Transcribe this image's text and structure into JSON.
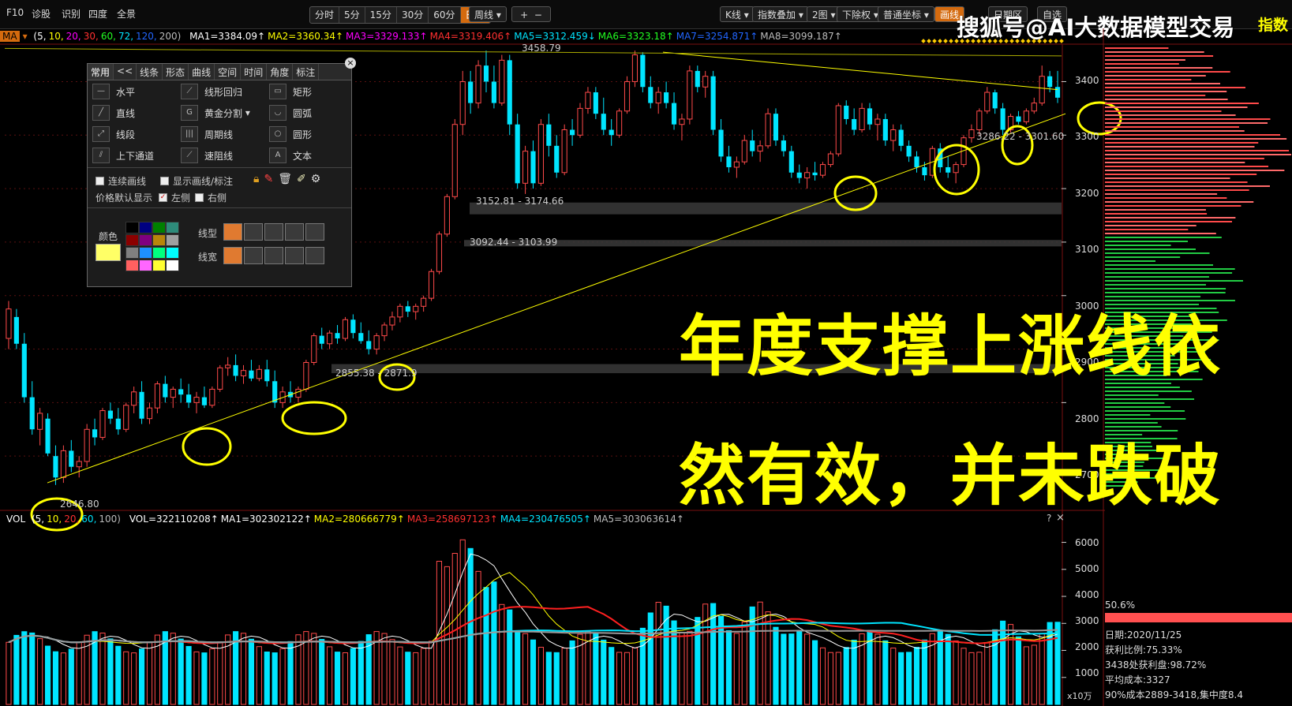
{
  "toolbar": {
    "left_items": [
      "F10",
      "诊股",
      "识别",
      "四度",
      "全景"
    ],
    "periods": [
      "分时",
      "5分",
      "15分",
      "30分",
      "60分",
      "日线"
    ],
    "active_period": "日线",
    "week_select": "周线",
    "plus": "+",
    "minus": "−",
    "kline_select": "K线",
    "index_overlay": "指数叠加",
    "two_charts": "2图",
    "exright": "下除权",
    "coord": "普通坐标",
    "draw_line": "画线",
    "right_partial": "日期区",
    "self_select": "自选"
  },
  "watermark": "搜狐号@AI大数据模型交易",
  "corner_label": "指数",
  "ma_bar": {
    "tag": "MA",
    "params": [
      {
        "text": "(5,",
        "color": "#ffffff"
      },
      {
        "text": "10,",
        "color": "#ffff00"
      },
      {
        "text": "20,",
        "color": "#ff00ff"
      },
      {
        "text": "30,",
        "color": "#ff3030"
      },
      {
        "text": "60,",
        "color": "#22ff22"
      },
      {
        "text": "72,",
        "color": "#00e5ff"
      },
      {
        "text": "120,",
        "color": "#2266ff"
      },
      {
        "text": "200)",
        "color": "#bbbbbb"
      }
    ],
    "values": [
      {
        "text": "MA1=3384.09↑",
        "color": "#ffffff"
      },
      {
        "text": "MA2=3360.34↑",
        "color": "#ffff00"
      },
      {
        "text": "MA3=3329.133↑",
        "color": "#ff00ff"
      },
      {
        "text": "MA4=3319.406↑",
        "color": "#ff3030"
      },
      {
        "text": "MA5=3312.459↓",
        "color": "#00e5ff"
      },
      {
        "text": "MA6=3323.18↑",
        "color": "#22ff22"
      },
      {
        "text": "MA7=3254.871↑",
        "color": "#2266ff"
      },
      {
        "text": "MA8=3099.187↑",
        "color": "#bbbbbb"
      }
    ]
  },
  "draw_panel": {
    "tabs": [
      "常用",
      "<<",
      "线条",
      "形态",
      "曲线",
      "空间",
      "时间",
      "角度",
      "标注"
    ],
    "tools": [
      [
        "水平",
        "线形回归",
        "矩形"
      ],
      [
        "直线",
        "黄金分割",
        "圆弧"
      ],
      [
        "线段",
        "周期线",
        "圆形"
      ],
      [
        "上下通道",
        "速阻线",
        "文本"
      ]
    ],
    "opt_continuous": "连续画线",
    "opt_show": "显示画线/标注",
    "opt_price_default": "价格默认显示",
    "opt_left": "左侧",
    "opt_right": "右侧",
    "color_label": "颜色",
    "linetype_label": "线型",
    "linewidth_label": "线宽",
    "swatch_colors": [
      "#000000",
      "#000080",
      "#008000",
      "#2e8b7a",
      "#8b0000",
      "#800080",
      "#b8860b",
      "#a0a0a0",
      "#808080",
      "#1e90ff",
      "#00ff7f",
      "#00ffff",
      "#ff6060",
      "#ff66ff",
      "#ffff33",
      "#ffffff"
    ],
    "selected_color": "#ffff66"
  },
  "price_labels": {
    "high": "3458.79",
    "low": "2646.80",
    "box1": "3152.81 - 3174.66",
    "box2": "3092.44 - 3103.99",
    "box3": "2855.38 - 2871.9",
    "box4": "3286.22 - 3301.60"
  },
  "price_axis": [
    "3400",
    "3300",
    "3200",
    "3100",
    "3000",
    "2900",
    "2800",
    "2700"
  ],
  "vol_axis": [
    "6000",
    "5000",
    "4000",
    "3000",
    "2000",
    "1000"
  ],
  "vol_unit": "x10万",
  "vol_bar": {
    "tag": "VOL",
    "params": [
      {
        "text": "(5,",
        "color": "#ffffff"
      },
      {
        "text": "10,",
        "color": "#ffff00"
      },
      {
        "text": "20,",
        "color": "#ff3030"
      },
      {
        "text": "60,",
        "color": "#00e5ff"
      },
      {
        "text": "100)",
        "color": "#bbbbbb"
      }
    ],
    "values": [
      {
        "text": "VOL=322110208↑",
        "color": "#ffffff"
      },
      {
        "text": "MA1=302302122↑",
        "color": "#ffffff"
      },
      {
        "text": "MA2=280666779↑",
        "color": "#ffff00"
      },
      {
        "text": "MA3=258697123↑",
        "color": "#ff3030"
      },
      {
        "text": "MA4=230476505↑",
        "color": "#00e5ff"
      },
      {
        "text": "MA5=303063614↑",
        "color": "#bbbbbb"
      }
    ],
    "help": "?",
    "close": "×"
  },
  "overlay_text": {
    "line1": "年度支撑上涨线依",
    "line2": "然有效，并未跌破"
  },
  "right_info": {
    "percent": "50.6%",
    "date": "日期:2020/11/25",
    "profit_ratio": "获利比例:75.33%",
    "profit_plate": "3438处获利盘:98.72%",
    "avg_cost": "平均成本:3327",
    "cost_90": "90%成本2889-3418,集中度8.4"
  },
  "colors": {
    "up": "#ff4a4a",
    "down": "#00e5ff",
    "trend": "#ffff00",
    "circle": "#ffff00",
    "active": "#d46a0e"
  },
  "chart_data": {
    "type": "candlestick",
    "series_note": "",
    "price_range": [
      2600,
      3470
    ],
    "candles": [
      {
        "o": 2920,
        "h": 2990,
        "l": 2900,
        "c": 2975
      },
      {
        "o": 2960,
        "h": 2975,
        "l": 2900,
        "c": 2910
      },
      {
        "o": 2910,
        "h": 2930,
        "l": 2800,
        "c": 2810
      },
      {
        "o": 2810,
        "h": 2840,
        "l": 2740,
        "c": 2750
      },
      {
        "o": 2750,
        "h": 2790,
        "l": 2720,
        "c": 2780
      },
      {
        "o": 2770,
        "h": 2780,
        "l": 2700,
        "c": 2705
      },
      {
        "o": 2700,
        "h": 2720,
        "l": 2646,
        "c": 2660
      },
      {
        "o": 2660,
        "h": 2720,
        "l": 2650,
        "c": 2710
      },
      {
        "o": 2710,
        "h": 2730,
        "l": 2670,
        "c": 2680
      },
      {
        "o": 2680,
        "h": 2700,
        "l": 2660,
        "c": 2690
      },
      {
        "o": 2690,
        "h": 2760,
        "l": 2680,
        "c": 2750
      },
      {
        "o": 2750,
        "h": 2770,
        "l": 2720,
        "c": 2735
      },
      {
        "o": 2735,
        "h": 2790,
        "l": 2730,
        "c": 2785
      },
      {
        "o": 2785,
        "h": 2800,
        "l": 2760,
        "c": 2770
      },
      {
        "o": 2770,
        "h": 2790,
        "l": 2740,
        "c": 2750
      },
      {
        "o": 2750,
        "h": 2800,
        "l": 2745,
        "c": 2795
      },
      {
        "o": 2795,
        "h": 2830,
        "l": 2780,
        "c": 2820
      },
      {
        "o": 2820,
        "h": 2840,
        "l": 2760,
        "c": 2770
      },
      {
        "o": 2770,
        "h": 2800,
        "l": 2760,
        "c": 2790
      },
      {
        "o": 2790,
        "h": 2840,
        "l": 2780,
        "c": 2835
      },
      {
        "o": 2835,
        "h": 2850,
        "l": 2800,
        "c": 2810
      },
      {
        "o": 2810,
        "h": 2830,
        "l": 2790,
        "c": 2825
      },
      {
        "o": 2825,
        "h": 2845,
        "l": 2800,
        "c": 2815
      },
      {
        "o": 2815,
        "h": 2835,
        "l": 2790,
        "c": 2800
      },
      {
        "o": 2800,
        "h": 2820,
        "l": 2780,
        "c": 2810
      },
      {
        "o": 2810,
        "h": 2830,
        "l": 2790,
        "c": 2795
      },
      {
        "o": 2795,
        "h": 2830,
        "l": 2790,
        "c": 2825
      },
      {
        "o": 2825,
        "h": 2870,
        "l": 2820,
        "c": 2865
      },
      {
        "o": 2865,
        "h": 2885,
        "l": 2850,
        "c": 2870
      },
      {
        "o": 2870,
        "h": 2890,
        "l": 2840,
        "c": 2850
      },
      {
        "o": 2850,
        "h": 2870,
        "l": 2835,
        "c": 2860
      },
      {
        "o": 2860,
        "h": 2880,
        "l": 2840,
        "c": 2845
      },
      {
        "o": 2845,
        "h": 2870,
        "l": 2840,
        "c": 2862
      },
      {
        "o": 2862,
        "h": 2880,
        "l": 2830,
        "c": 2840
      },
      {
        "o": 2840,
        "h": 2860,
        "l": 2790,
        "c": 2800
      },
      {
        "o": 2800,
        "h": 2830,
        "l": 2790,
        "c": 2820
      },
      {
        "o": 2820,
        "h": 2840,
        "l": 2800,
        "c": 2810
      },
      {
        "o": 2810,
        "h": 2830,
        "l": 2800,
        "c": 2825
      },
      {
        "o": 2825,
        "h": 2880,
        "l": 2820,
        "c": 2875
      },
      {
        "o": 2875,
        "h": 2930,
        "l": 2870,
        "c": 2925
      },
      {
        "o": 2925,
        "h": 2940,
        "l": 2900,
        "c": 2910
      },
      {
        "o": 2910,
        "h": 2935,
        "l": 2900,
        "c": 2930
      },
      {
        "o": 2930,
        "h": 2945,
        "l": 2910,
        "c": 2920
      },
      {
        "o": 2920,
        "h": 2960,
        "l": 2915,
        "c": 2955
      },
      {
        "o": 2955,
        "h": 2965,
        "l": 2920,
        "c": 2930
      },
      {
        "o": 2930,
        "h": 2950,
        "l": 2910,
        "c": 2915
      },
      {
        "o": 2915,
        "h": 2935,
        "l": 2890,
        "c": 2900
      },
      {
        "o": 2900,
        "h": 2930,
        "l": 2890,
        "c": 2925
      },
      {
        "o": 2925,
        "h": 2950,
        "l": 2915,
        "c": 2945
      },
      {
        "o": 2945,
        "h": 2970,
        "l": 2935,
        "c": 2960
      },
      {
        "o": 2960,
        "h": 2985,
        "l": 2950,
        "c": 2980
      },
      {
        "o": 2980,
        "h": 2990,
        "l": 2960,
        "c": 2970
      },
      {
        "o": 2970,
        "h": 2985,
        "l": 2955,
        "c": 2980
      },
      {
        "o": 2980,
        "h": 3000,
        "l": 2970,
        "c": 2995
      },
      {
        "o": 2995,
        "h": 3050,
        "l": 2990,
        "c": 3045
      },
      {
        "o": 3045,
        "h": 3120,
        "l": 3040,
        "c": 3115
      },
      {
        "o": 3115,
        "h": 3190,
        "l": 3110,
        "c": 3185
      },
      {
        "o": 3185,
        "h": 3330,
        "l": 3180,
        "c": 3320
      },
      {
        "o": 3320,
        "h": 3420,
        "l": 3300,
        "c": 3400
      },
      {
        "o": 3400,
        "h": 3420,
        "l": 3340,
        "c": 3360
      },
      {
        "o": 3360,
        "h": 3440,
        "l": 3350,
        "c": 3430
      },
      {
        "o": 3430,
        "h": 3458,
        "l": 3380,
        "c": 3400
      },
      {
        "o": 3400,
        "h": 3430,
        "l": 3350,
        "c": 3360
      },
      {
        "o": 3360,
        "h": 3450,
        "l": 3355,
        "c": 3440
      },
      {
        "o": 3440,
        "h": 3450,
        "l": 3300,
        "c": 3320
      },
      {
        "o": 3320,
        "h": 3340,
        "l": 3200,
        "c": 3210
      },
      {
        "o": 3210,
        "h": 3280,
        "l": 3190,
        "c": 3270
      },
      {
        "o": 3270,
        "h": 3290,
        "l": 3200,
        "c": 3210
      },
      {
        "o": 3210,
        "h": 3330,
        "l": 3205,
        "c": 3320
      },
      {
        "o": 3320,
        "h": 3340,
        "l": 3260,
        "c": 3280
      },
      {
        "o": 3280,
        "h": 3300,
        "l": 3220,
        "c": 3230
      },
      {
        "o": 3230,
        "h": 3320,
        "l": 3225,
        "c": 3310
      },
      {
        "o": 3310,
        "h": 3330,
        "l": 3280,
        "c": 3300
      },
      {
        "o": 3300,
        "h": 3360,
        "l": 3295,
        "c": 3350
      },
      {
        "o": 3350,
        "h": 3390,
        "l": 3340,
        "c": 3380
      },
      {
        "o": 3380,
        "h": 3390,
        "l": 3330,
        "c": 3340
      },
      {
        "o": 3340,
        "h": 3370,
        "l": 3300,
        "c": 3310
      },
      {
        "o": 3310,
        "h": 3330,
        "l": 3280,
        "c": 3300
      },
      {
        "o": 3300,
        "h": 3350,
        "l": 3295,
        "c": 3345
      },
      {
        "o": 3345,
        "h": 3410,
        "l": 3340,
        "c": 3400
      },
      {
        "o": 3400,
        "h": 3458,
        "l": 3390,
        "c": 3450
      },
      {
        "o": 3450,
        "h": 3455,
        "l": 3380,
        "c": 3390
      },
      {
        "o": 3390,
        "h": 3410,
        "l": 3350,
        "c": 3360
      },
      {
        "o": 3360,
        "h": 3390,
        "l": 3340,
        "c": 3380
      },
      {
        "o": 3380,
        "h": 3400,
        "l": 3350,
        "c": 3360
      },
      {
        "o": 3360,
        "h": 3380,
        "l": 3310,
        "c": 3320
      },
      {
        "o": 3320,
        "h": 3340,
        "l": 3290,
        "c": 3330
      },
      {
        "o": 3330,
        "h": 3430,
        "l": 3320,
        "c": 3420
      },
      {
        "o": 3420,
        "h": 3430,
        "l": 3380,
        "c": 3390
      },
      {
        "o": 3390,
        "h": 3420,
        "l": 3370,
        "c": 3410
      },
      {
        "o": 3410,
        "h": 3420,
        "l": 3300,
        "c": 3310
      },
      {
        "o": 3310,
        "h": 3330,
        "l": 3250,
        "c": 3260
      },
      {
        "o": 3260,
        "h": 3280,
        "l": 3230,
        "c": 3240
      },
      {
        "o": 3240,
        "h": 3260,
        "l": 3220,
        "c": 3250
      },
      {
        "o": 3250,
        "h": 3300,
        "l": 3245,
        "c": 3290
      },
      {
        "o": 3290,
        "h": 3310,
        "l": 3260,
        "c": 3270
      },
      {
        "o": 3270,
        "h": 3290,
        "l": 3250,
        "c": 3280
      },
      {
        "o": 3280,
        "h": 3350,
        "l": 3275,
        "c": 3340
      },
      {
        "o": 3340,
        "h": 3350,
        "l": 3280,
        "c": 3290
      },
      {
        "o": 3290,
        "h": 3300,
        "l": 3260,
        "c": 3270
      },
      {
        "o": 3270,
        "h": 3280,
        "l": 3220,
        "c": 3230
      },
      {
        "o": 3230,
        "h": 3245,
        "l": 3210,
        "c": 3220
      },
      {
        "o": 3220,
        "h": 3240,
        "l": 3200,
        "c": 3230
      },
      {
        "o": 3230,
        "h": 3250,
        "l": 3215,
        "c": 3225
      },
      {
        "o": 3225,
        "h": 3250,
        "l": 3220,
        "c": 3245
      },
      {
        "o": 3245,
        "h": 3270,
        "l": 3240,
        "c": 3265
      },
      {
        "o": 3265,
        "h": 3360,
        "l": 3260,
        "c": 3355
      },
      {
        "o": 3355,
        "h": 3365,
        "l": 3320,
        "c": 3330
      },
      {
        "o": 3330,
        "h": 3350,
        "l": 3300,
        "c": 3310
      },
      {
        "o": 3310,
        "h": 3360,
        "l": 3305,
        "c": 3350
      },
      {
        "o": 3350,
        "h": 3360,
        "l": 3310,
        "c": 3320
      },
      {
        "o": 3320,
        "h": 3340,
        "l": 3290,
        "c": 3330
      },
      {
        "o": 3330,
        "h": 3340,
        "l": 3280,
        "c": 3290
      },
      {
        "o": 3290,
        "h": 3320,
        "l": 3270,
        "c": 3310
      },
      {
        "o": 3310,
        "h": 3320,
        "l": 3270,
        "c": 3280
      },
      {
        "o": 3280,
        "h": 3290,
        "l": 3250,
        "c": 3260
      },
      {
        "o": 3260,
        "h": 3270,
        "l": 3230,
        "c": 3240
      },
      {
        "o": 3240,
        "h": 3250,
        "l": 3215,
        "c": 3225
      },
      {
        "o": 3225,
        "h": 3280,
        "l": 3220,
        "c": 3275
      },
      {
        "o": 3275,
        "h": 3285,
        "l": 3230,
        "c": 3240
      },
      {
        "o": 3240,
        "h": 3260,
        "l": 3220,
        "c": 3230
      },
      {
        "o": 3230,
        "h": 3250,
        "l": 3210,
        "c": 3245
      },
      {
        "o": 3245,
        "h": 3300,
        "l": 3240,
        "c": 3295
      },
      {
        "o": 3295,
        "h": 3320,
        "l": 3286,
        "c": 3310
      },
      {
        "o": 3310,
        "h": 3350,
        "l": 3300,
        "c": 3345
      },
      {
        "o": 3345,
        "h": 3390,
        "l": 3340,
        "c": 3380
      },
      {
        "o": 3380,
        "h": 3385,
        "l": 3340,
        "c": 3350
      },
      {
        "o": 3350,
        "h": 3360,
        "l": 3300,
        "c": 3310
      },
      {
        "o": 3310,
        "h": 3340,
        "l": 3305,
        "c": 3335
      },
      {
        "o": 3335,
        "h": 3345,
        "l": 3320,
        "c": 3325
      },
      {
        "o": 3325,
        "h": 3350,
        "l": 3320,
        "c": 3345
      },
      {
        "o": 3345,
        "h": 3370,
        "l": 3340,
        "c": 3360
      },
      {
        "o": 3360,
        "h": 3430,
        "l": 3355,
        "c": 3410
      },
      {
        "o": 3410,
        "h": 3420,
        "l": 3380,
        "c": 3390
      },
      {
        "o": 3390,
        "h": 3420,
        "l": 3360,
        "c": 3370
      }
    ]
  }
}
